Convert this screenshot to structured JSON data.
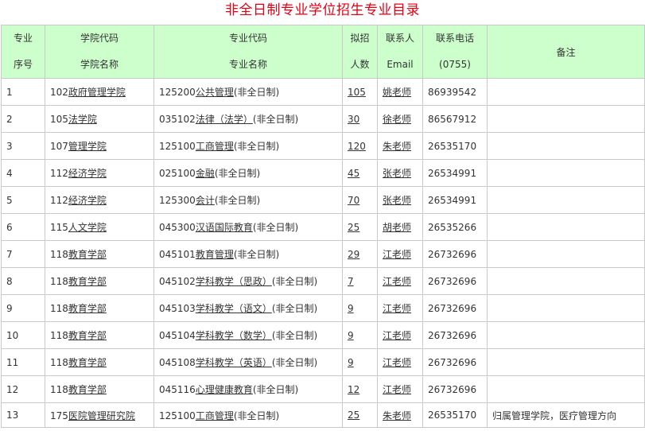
{
  "title": "非全日制专业学位招生专业目录",
  "header": {
    "seq": [
      "专业",
      "序号"
    ],
    "school": [
      "学院代码",
      "学院名称"
    ],
    "major": [
      "专业代码",
      "专业名称"
    ],
    "quota": [
      "拟招",
      "人数"
    ],
    "contact": [
      "联系人",
      "Email"
    ],
    "phone": [
      "联系电话",
      "(0755)"
    ],
    "notes": "备注"
  },
  "rows": [
    {
      "seq": "1",
      "school_code": "102",
      "school_name": "政府管理学院",
      "major_code": "125200",
      "major_name": "公共管理",
      "mode": "(非全日制)",
      "quota": "105",
      "contact": "姚老师",
      "phone": "86939542",
      "notes": ""
    },
    {
      "seq": "2",
      "school_code": "105",
      "school_name": "法学院",
      "major_code": "035102",
      "major_name": "法律（法学）",
      "mode": "(非全日制)",
      "quota": "30",
      "contact": "徐老师",
      "phone": "86567912",
      "notes": ""
    },
    {
      "seq": "3",
      "school_code": "107",
      "school_name": "管理学院",
      "major_code": "125100",
      "major_name": "工商管理",
      "mode": "(非全日制)",
      "quota": "120",
      "contact": "朱老师",
      "phone": "26535170",
      "notes": ""
    },
    {
      "seq": "4",
      "school_code": "112",
      "school_name": "经济学院",
      "major_code": "025100",
      "major_name": "金融",
      "mode": "(非全日制)",
      "quota": "45",
      "contact": "张老师",
      "phone": "26534991",
      "notes": ""
    },
    {
      "seq": "5",
      "school_code": "112",
      "school_name": "经济学院",
      "major_code": "125300",
      "major_name": "会计",
      "mode": "(非全日制)",
      "quota": "70",
      "contact": "张老师",
      "phone": "26534991",
      "notes": ""
    },
    {
      "seq": "6",
      "school_code": "115",
      "school_name": "人文学院",
      "major_code": "045300",
      "major_name": "汉语国际教育",
      "mode": "(非全日制)",
      "quota": "25",
      "contact": "胡老师",
      "phone": "26535266",
      "notes": ""
    },
    {
      "seq": "7",
      "school_code": "118",
      "school_name": "教育学部",
      "major_code": "045101",
      "major_name": "教育管理",
      "mode": "(非全日制)",
      "quota": "29",
      "contact": "江老师",
      "phone": "26732696",
      "notes": ""
    },
    {
      "seq": "8",
      "school_code": "118",
      "school_name": "教育学部",
      "major_code": "045102",
      "major_name": "学科教学（思政）",
      "mode": "(非全日制)",
      "quota": "7",
      "contact": "江老师",
      "phone": "26732696",
      "notes": ""
    },
    {
      "seq": "9",
      "school_code": "118",
      "school_name": "教育学部",
      "major_code": "045103",
      "major_name": "学科教学（语文）",
      "mode": "(非全日制)",
      "quota": "9",
      "contact": "江老师",
      "phone": "26732696",
      "notes": ""
    },
    {
      "seq": "10",
      "school_code": "118",
      "school_name": "教育学部",
      "major_code": "045104",
      "major_name": "学科教学（数学）",
      "mode": "(非全日制)",
      "quota": "9",
      "contact": "江老师",
      "phone": "26732696",
      "notes": ""
    },
    {
      "seq": "11",
      "school_code": "118",
      "school_name": "教育学部",
      "major_code": "045108",
      "major_name": "学科教学（英语）",
      "mode": "(非全日制)",
      "quota": "9",
      "contact": "江老师",
      "phone": "26732696",
      "notes": ""
    },
    {
      "seq": "12",
      "school_code": "118",
      "school_name": "教育学部",
      "major_code": "045116",
      "major_name": "心理健康教育",
      "mode": "(非全日制)",
      "quota": "12",
      "contact": "江老师",
      "phone": "26732696",
      "notes": ""
    },
    {
      "seq": "13",
      "school_code": "175",
      "school_name": "医院管理研究院",
      "major_code": "125100",
      "major_name": "工商管理",
      "mode": "(非全日制)",
      "quota": "25",
      "contact": "朱老师",
      "phone": "26535170",
      "notes": "归属管理学院，医疗管理方向"
    }
  ]
}
